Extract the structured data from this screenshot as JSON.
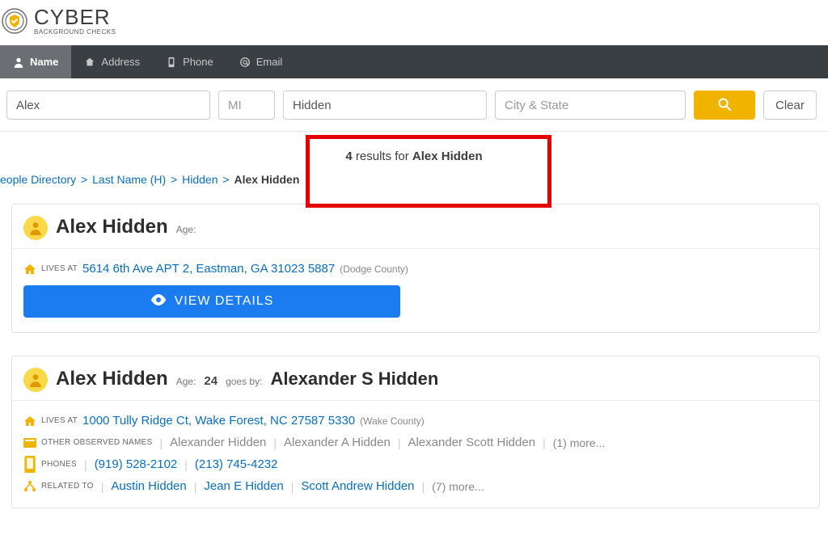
{
  "brand": {
    "main": "CYBER",
    "sub": "BACKGROUND CHECKS"
  },
  "nav": {
    "name": "Name",
    "address": "Address",
    "phone": "Phone",
    "email": "Email"
  },
  "search": {
    "first_val": "Alex",
    "mi_placeholder": "MI",
    "last_val": "Hidden",
    "city_placeholder": "City & State",
    "clear": "Clear"
  },
  "results": {
    "count": "4",
    "mid": " results for ",
    "query": "Alex Hidden"
  },
  "crumb": {
    "a": "eople Directory",
    "b": "Last Name (H)",
    "c": "Hidden",
    "d": "Alex Hidden"
  },
  "details_btn": "VIEW DETAILS",
  "labels": {
    "age": "Age:",
    "goesby": "goes by:",
    "lives": "LIVES AT",
    "other": "OTHER OBSERVED NAMES",
    "phones": "PHONES",
    "related": "RELATED TO"
  },
  "cards": [
    {
      "name": "Alex Hidden",
      "age": "",
      "addr": "5614 6th Ave APT 2, Eastman, GA 31023 5887",
      "county": "(Dodge County)"
    },
    {
      "name": "Alex Hidden",
      "age": "24",
      "goesby": "Alexander S Hidden",
      "addr": "1000 Tully Ridge Ct, Wake Forest, NC 27587 5330",
      "county": "(Wake County)",
      "aliases": [
        "Alexander Hidden",
        "Alexander A Hidden",
        "Alexander Scott Hidden"
      ],
      "alias_more": "(1) more...",
      "phones": [
        "(919) 528-2102",
        "(213) 745-4232"
      ],
      "related": [
        "Austin Hidden",
        "Jean E Hidden",
        "Scott Andrew Hidden"
      ],
      "related_more": "(7) more..."
    }
  ]
}
